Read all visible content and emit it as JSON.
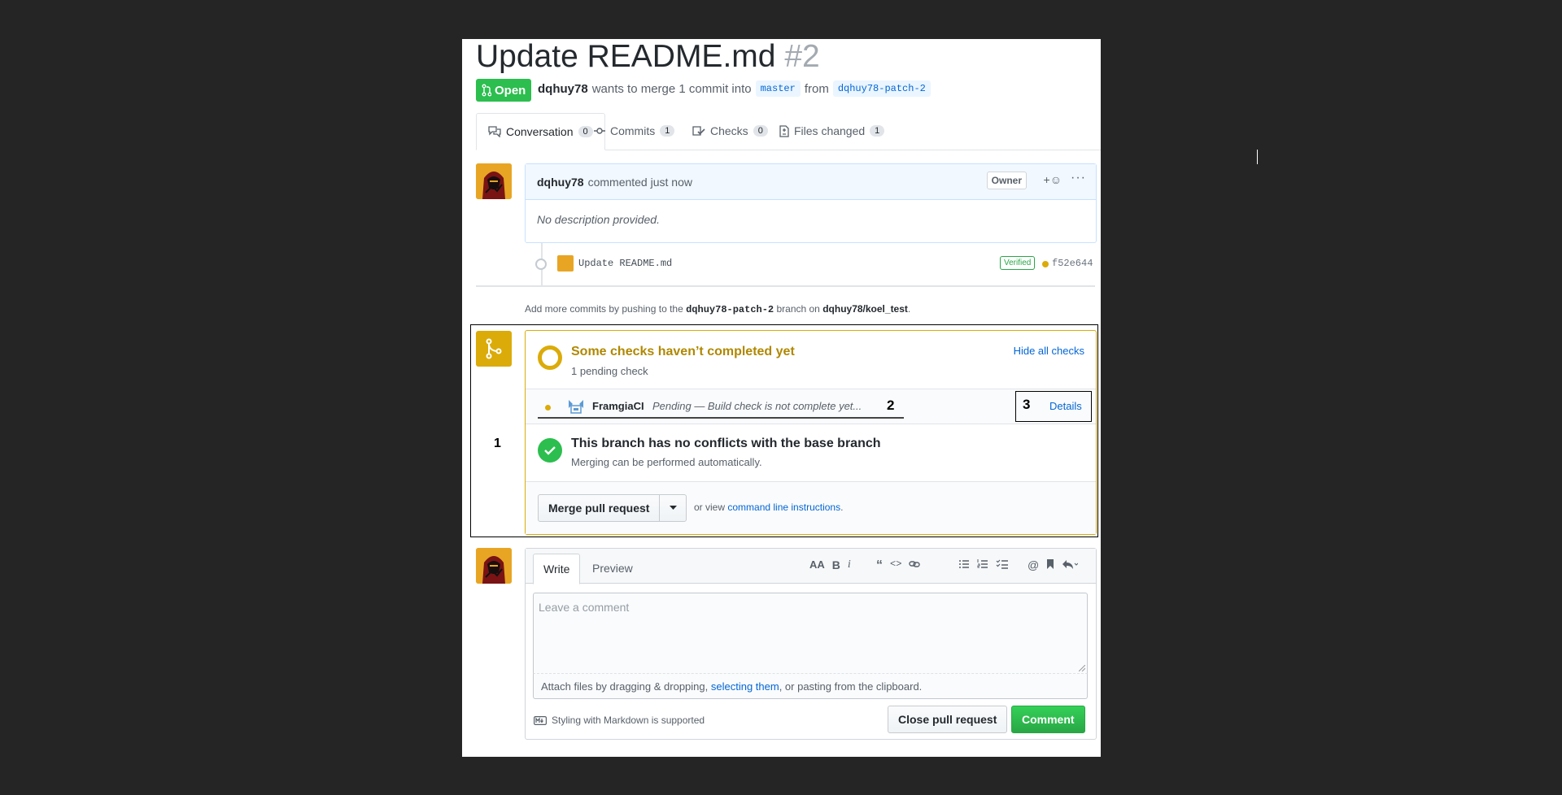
{
  "pr": {
    "title": "Update README.md",
    "number": "#2",
    "state": "Open",
    "author": "dqhuy78",
    "merge_text": "wants to merge 1 commit into",
    "base_branch": "master",
    "from_text": "from",
    "head_branch": "dqhuy78-patch-2"
  },
  "tabs": [
    {
      "label": "Conversation",
      "count": "0",
      "icon": "comment-discussion-icon"
    },
    {
      "label": "Commits",
      "count": "1",
      "icon": "git-commit-icon"
    },
    {
      "label": "Checks",
      "count": "0",
      "icon": "checklist-icon"
    },
    {
      "label": "Files changed",
      "count": "1",
      "icon": "file-diff-icon"
    }
  ],
  "comment": {
    "author": "dqhuy78",
    "action": "commented just now",
    "role_badge": "Owner",
    "reaction": "+☺",
    "more": "···",
    "body": "No description provided."
  },
  "commit": {
    "message": "Update README.md",
    "verified": "Verified",
    "sha": "f52e644"
  },
  "hint": {
    "prefix": "Add more commits by pushing to the",
    "branch": "dqhuy78-patch-2",
    "middle": "branch on",
    "repo": "dqhuy78/koel_test",
    "suffix": "."
  },
  "checks": {
    "title": "Some checks haven’t completed yet",
    "subtitle": "1 pending check",
    "hide_label": "Hide all checks",
    "ci_name": "FramgiaCI",
    "ci_status": "Pending — Build check is not complete yet...",
    "details_label": "Details"
  },
  "annotations": {
    "one": "1",
    "two": "2",
    "three": "3"
  },
  "merge": {
    "title": "This branch has no conflicts with the base branch",
    "subtitle": "Merging can be performed automatically.",
    "button": "Merge pull request",
    "or_view": "or view",
    "cli_link": "command line instructions",
    "period": "."
  },
  "form": {
    "tab_write": "Write",
    "tab_preview": "Preview",
    "placeholder": "Leave a comment",
    "attach_prefix": "Attach files by dragging & dropping,",
    "attach_link": "selecting them",
    "attach_suffix": ", or pasting from the clipboard.",
    "markdown_note": "Styling with Markdown is supported",
    "close_button": "Close pull request",
    "comment_button": "Comment"
  },
  "colors": {
    "open_green": "#2cbe4e",
    "pending_yellow": "#dbab09",
    "link_blue": "#0366d6",
    "backdrop": "#252525"
  }
}
